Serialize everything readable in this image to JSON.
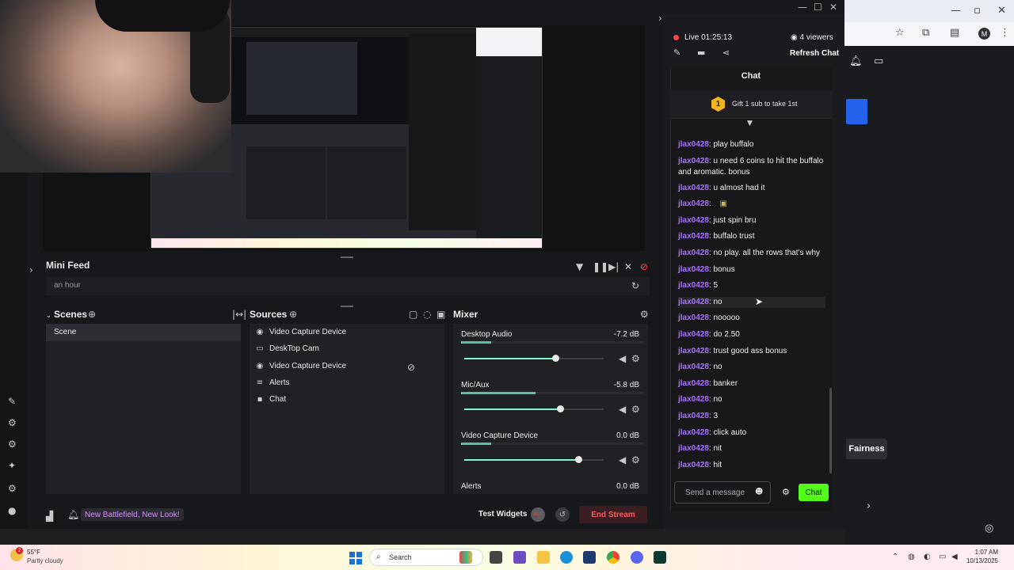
{
  "window": {
    "minimize": "—",
    "maximize": "☐",
    "close": "✕"
  },
  "stream": {
    "live_label": "Live 01:25:13",
    "viewers": "4 viewers",
    "refresh_chat": "Refresh Chat"
  },
  "mini_feed": {
    "title": "Mini Feed",
    "item": "an hour"
  },
  "scenes": {
    "title": "Scenes",
    "items": [
      "Scene"
    ]
  },
  "sources": {
    "title": "Sources",
    "items": [
      {
        "label": "Video Capture Device",
        "icon": "camera-icon"
      },
      {
        "label": "DeskTop Cam",
        "icon": "monitor-icon"
      },
      {
        "label": "Video Capture Device",
        "icon": "camera-icon"
      },
      {
        "label": "Alerts",
        "icon": "bell-icon"
      },
      {
        "label": "Chat",
        "icon": "chat-icon"
      }
    ]
  },
  "mixer": {
    "title": "Mixer",
    "channels": [
      {
        "name": "Desktop Audio",
        "db": "-7.2 dB",
        "level": 0.8
      },
      {
        "name": "Mic/Aux",
        "db": "-5.8 dB",
        "level": 0.84
      },
      {
        "name": "Video Capture Device",
        "db": "0.0 dB",
        "level": 1.0
      },
      {
        "name": "Alerts",
        "db": "0.0 dB",
        "level": 1.0
      }
    ]
  },
  "footer": {
    "news": "New Battlefield, New Look!",
    "test_widgets": "Test Widgets",
    "rec": "REC",
    "end_stream": "End Stream"
  },
  "chat": {
    "title": "Chat",
    "gift_badge": "1",
    "gift_text": "Gift 1 sub to take 1st",
    "placeholder": "Send a message",
    "send_label": "Chat",
    "messages": [
      {
        "user": "jlax0428",
        "text": ": play buffalo"
      },
      {
        "user": "jlax0428",
        "text": ": u need 6 coins to hit the buffalo and aromatic. bonus"
      },
      {
        "user": "jlax0428",
        "text": ": u almost had it"
      },
      {
        "user": "jlax0428",
        "text": ": "
      },
      {
        "user": "jlax0428",
        "text": ": just spin bru"
      },
      {
        "user": "jlax0428",
        "text": ": buffalo trust"
      },
      {
        "user": "jlax0428",
        "text": ": no play. all the rows that's why"
      },
      {
        "user": "jlax0428",
        "text": ": bonus"
      },
      {
        "user": "jlax0428",
        "text": ": 5"
      },
      {
        "user": "jlax0428",
        "text": ": no"
      },
      {
        "user": "jlax0428",
        "text": ": nooooo"
      },
      {
        "user": "jlax0428",
        "text": ": do 2.50"
      },
      {
        "user": "jlax0428",
        "text": ": trust good ass bonus"
      },
      {
        "user": "jlax0428",
        "text": ": no"
      },
      {
        "user": "jlax0428",
        "text": ": banker"
      },
      {
        "user": "jlax0428",
        "text": ": no"
      },
      {
        "user": "jlax0428",
        "text": ": 3"
      },
      {
        "user": "jlax0428",
        "text": ": click auto"
      },
      {
        "user": "jlax0428",
        "text": ": nit"
      },
      {
        "user": "jlax0428",
        "text": ": hit"
      }
    ]
  },
  "browser_bg": {
    "fairness_label": "Fairness",
    "profile_initial": "M"
  },
  "taskbar": {
    "weather_temp": "55°F",
    "weather_desc": "Partly cloudy",
    "weather_badge": "2",
    "search_label": "Search",
    "time": "1:07 AM",
    "date": "10/13/2025"
  },
  "colors": {
    "accent_green": "#53fc18",
    "username_purple": "#a970ff",
    "live_red": "#f04848",
    "slider_teal": "#80f5d2"
  }
}
